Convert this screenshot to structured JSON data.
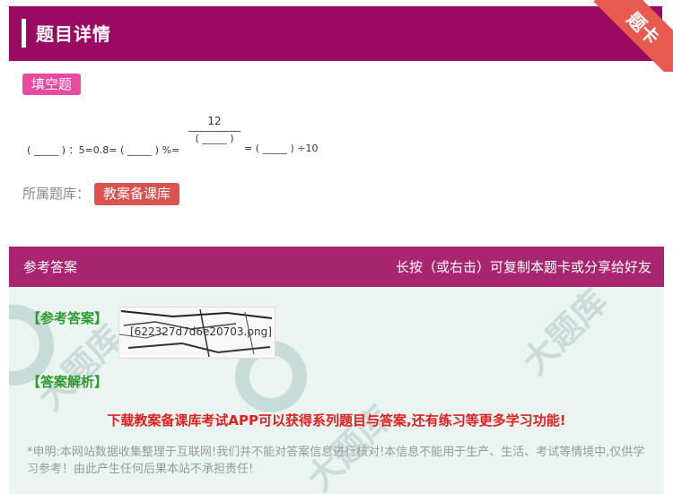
{
  "header": {
    "title": "题目详情",
    "corner_label": "题卡"
  },
  "question": {
    "type_tag": "填空题",
    "left_expr": "(  _____  ) ：5=0.8= (  _____  ) %=",
    "frac_num": "12",
    "frac_den": "(  _____  )",
    "right_expr": "= (  _____  ) ÷10"
  },
  "bank": {
    "label": "所属题库：",
    "tag": "教案备课库"
  },
  "answer": {
    "section_title": "参考答案",
    "hint": "长按（或右击）可复制本题卡或分享给好友",
    "ref_label": "【参考答案】",
    "image_name": "[622327d7d6e20703.png]",
    "analysis_label": "【答案解析】",
    "promo": "下载教案备课库考试APP可以获得系列题目与答案,还有练习等更多学习功能!",
    "disclaimer": "*申明:本网站数据收集整理于互联网!我们并不能对答案信息进行核对!本信息不能用于生产、生活、考试等情境中,仅供学习参考！由此产生任何后果本站不承担责任!"
  },
  "colors": {
    "header": "#9b0a62",
    "answer_header": "#a7266f",
    "tag": "#e64ba1",
    "bank_tag": "#d9534f",
    "promo": "#e02020"
  }
}
